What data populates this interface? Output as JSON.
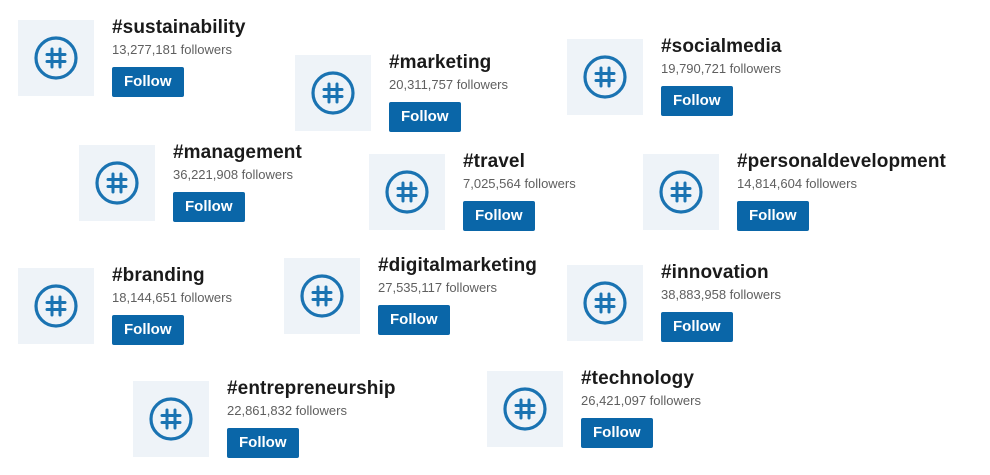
{
  "hashtags": [
    {
      "tag": "#sustainability",
      "followers": "13,277,181 followers",
      "button": "Follow"
    },
    {
      "tag": "#marketing",
      "followers": "20,311,757 followers",
      "button": "Follow"
    },
    {
      "tag": "#socialmedia",
      "followers": "19,790,721 followers",
      "button": "Follow"
    },
    {
      "tag": "#management",
      "followers": "36,221,908 followers",
      "button": "Follow"
    },
    {
      "tag": "#travel",
      "followers": "7,025,564 followers",
      "button": "Follow"
    },
    {
      "tag": "#personaldevelopment",
      "followers": "14,814,604 followers",
      "button": "Follow"
    },
    {
      "tag": "#branding",
      "followers": "18,144,651 followers",
      "button": "Follow"
    },
    {
      "tag": "#digitalmarketing",
      "followers": "27,535,117 followers",
      "button": "Follow"
    },
    {
      "tag": "#innovation",
      "followers": "38,883,958 followers",
      "button": "Follow"
    },
    {
      "tag": "#entrepreneurship",
      "followers": "22,861,832 followers",
      "button": "Follow"
    },
    {
      "tag": "#technology",
      "followers": "26,421,097 followers",
      "button": "Follow"
    }
  ],
  "colors": {
    "follow_button": "#0a66a8",
    "icon_background": "#eef3f8",
    "hashtag_icon": "#1a73b2"
  },
  "icon": "hashtag-icon"
}
